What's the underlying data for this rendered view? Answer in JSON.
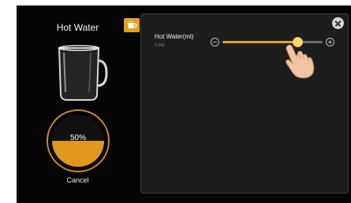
{
  "product": {
    "title": "Hot Water"
  },
  "progress": {
    "label": "50%",
    "fraction": 0.5
  },
  "actions": {
    "cancel_label": "Cancel"
  },
  "dialog": {
    "title": "Hot Water(ml)",
    "range_label": "0 240",
    "slider": {
      "min": 0,
      "max": 240,
      "value": 180
    }
  },
  "icons": {
    "close": "close-icon",
    "minus": "minus-icon",
    "plus": "plus-icon",
    "tab": "cup-icon",
    "cup": "glass-mug-icon",
    "hand": "touch-hand-icon"
  },
  "colors": {
    "accent": "#e2a21f",
    "liquid": "#e0981c",
    "background": "#050505",
    "dialog": "#1d1d1d"
  }
}
